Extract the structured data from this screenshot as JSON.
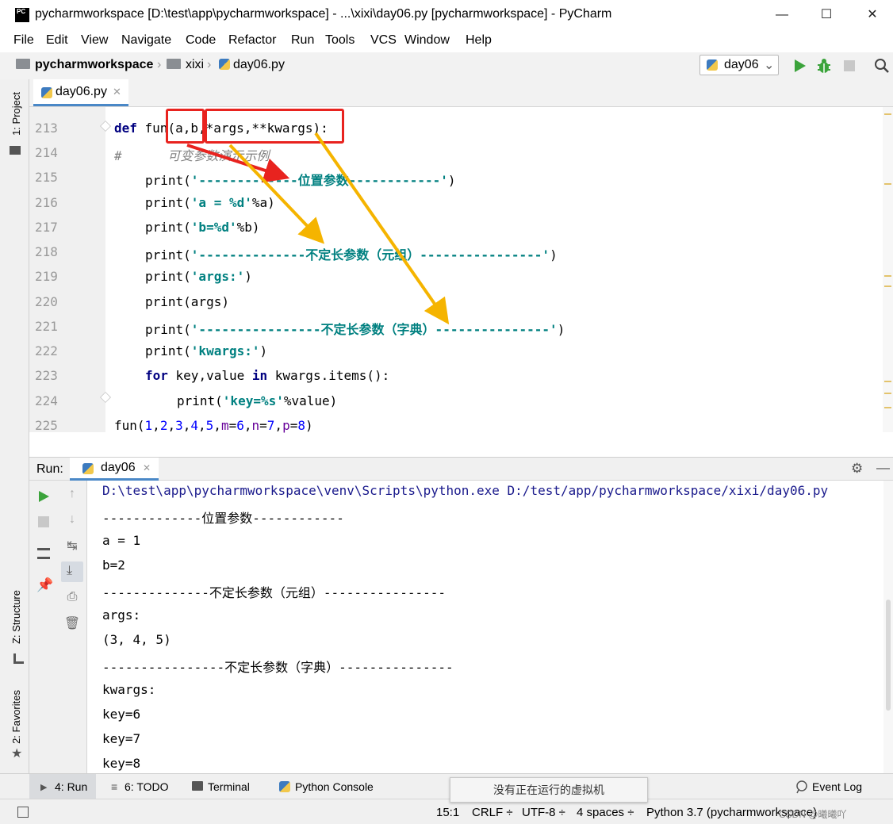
{
  "window": {
    "title": "pycharmworkspace [D:\\test\\app\\pycharmworkspace] - ...\\xixi\\day06.py [pycharmworkspace] - PyCharm",
    "logo_text": "PC"
  },
  "menu": [
    "File",
    "Edit",
    "View",
    "Navigate",
    "Code",
    "Refactor",
    "Run",
    "Tools",
    "VCS",
    "Window",
    "Help"
  ],
  "breadcrumb": [
    "pycharmworkspace",
    "xixi",
    "day06.py"
  ],
  "run_config": "day06",
  "left_stripe": {
    "project": "1: Project",
    "structure": "Z: Structure",
    "favorites": "2: Favorites"
  },
  "editor_tab": "day06.py",
  "editor": {
    "line_numbers": [
      "213",
      "214",
      "215",
      "216",
      "217",
      "218",
      "219",
      "220",
      "221",
      "222",
      "223",
      "224",
      "225"
    ],
    "comment_line": "#      可变参数演示示例",
    "lines": {
      "l213": {
        "kw": "def",
        "rest": " fun(a,b,*args,**kwargs):"
      },
      "l215": {
        "fn": "print(",
        "s": "'-------------位置参数------------'",
        "end": ")"
      },
      "l216": {
        "fn": "print(",
        "s": "'a = %d'",
        "end": "%a)"
      },
      "l217": {
        "fn": "print(",
        "s": "'b=%d'",
        "end": "%b)"
      },
      "l218": {
        "fn": "print(",
        "s": "'--------------不定长参数（元组）----------------'",
        "end": ")"
      },
      "l219": {
        "fn": "print(",
        "s": "'args:'",
        "end": ")"
      },
      "l220": {
        "fn": "print(args)"
      },
      "l221": {
        "fn": "print(",
        "s": "'----------------不定长参数（字典）---------------'",
        "end": ")"
      },
      "l222": {
        "fn": "print(",
        "s": "'kwargs:'",
        "end": ")"
      },
      "l223": {
        "kw1": "for",
        "mid": " key,value ",
        "kw2": "in",
        "end": " kwargs.items():"
      },
      "l224": {
        "fn": "print(",
        "s": "'key=%s'",
        "end": "%value)"
      },
      "l225": {
        "pre": "fun(",
        "n1": "1",
        "c1": ",",
        "n2": "2",
        "c2": ",",
        "n3": "3",
        "c3": ",",
        "n4": "4",
        "c4": ",",
        "n5": "5",
        "c5": ",",
        "k1": "m",
        "e1": "=",
        "n6": "6",
        "c6": ",",
        "k2": "n",
        "e2": "=",
        "n7": "7",
        "c7": ",",
        "k3": "p",
        "e3": "=",
        "n8": "8",
        "end": ")"
      }
    }
  },
  "run_panel": {
    "label": "Run:",
    "tab": "day06",
    "output": [
      "D:\\test\\app\\pycharmworkspace\\venv\\Scripts\\python.exe D:/test/app/pycharmworkspace/xixi/day06.py",
      "-------------位置参数------------",
      "a = 1",
      "b=2",
      "--------------不定长参数（元组）----------------",
      "args:",
      "(3, 4, 5)",
      "----------------不定长参数（字典）---------------",
      "kwargs:",
      "key=6",
      "key=7",
      "key=8"
    ]
  },
  "tool_windows": [
    "4: Run",
    "6: TODO",
    "Terminal",
    "Python Console",
    "Event Log"
  ],
  "popup": "没有正在运行的虚拟机",
  "status": {
    "position": "15:1",
    "line_sep": "CRLF ÷",
    "encoding": "UTF-8 ÷",
    "indent": "4 spaces ÷",
    "interpreter": "Python 3.7 (pycharmworkspace)"
  },
  "watermark": "CSDN @曦曦吖",
  "colors": {
    "keyword": "#000080",
    "string": "#008080",
    "annotation_red": "#e8231f",
    "annotation_arrow": "#f5b400",
    "accent": "#4a88c7"
  }
}
